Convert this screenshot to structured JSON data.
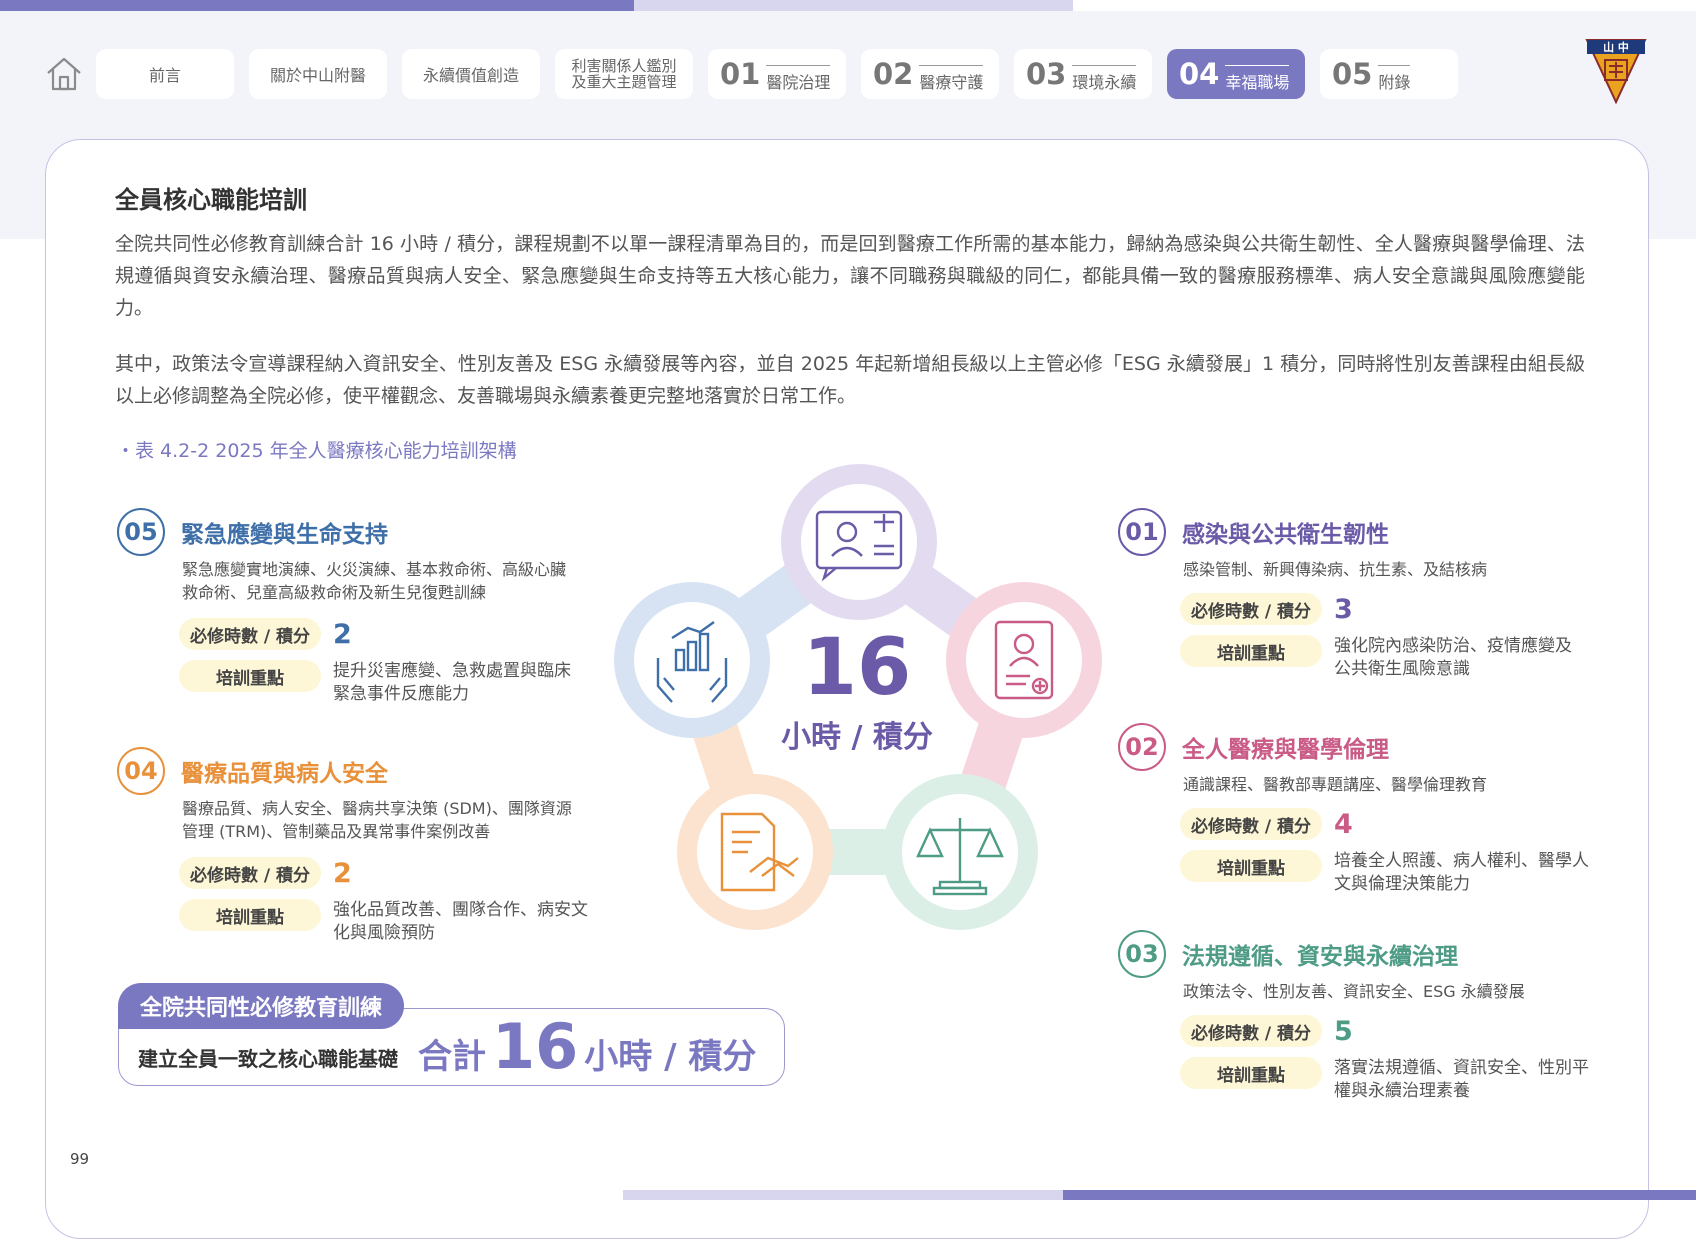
{
  "nav": {
    "tabs": [
      {
        "label": "前言"
      },
      {
        "label": "關於中山附醫"
      },
      {
        "label": "永續價值創造"
      },
      {
        "label_line1": "利害關係人鑑別",
        "label_line2": "及重大主題管理"
      },
      {
        "num": "01",
        "label": "醫院治理"
      },
      {
        "num": "02",
        "label": "醫療守護"
      },
      {
        "num": "03",
        "label": "環境永續"
      },
      {
        "num": "04",
        "label": "幸福職場"
      },
      {
        "num": "05",
        "label": "附錄"
      }
    ],
    "logo_text_top": "山 中"
  },
  "page": {
    "title": "全員核心職能培訓",
    "para1": "全院共同性必修教育訓練合計 16 小時 / 積分，課程規劃不以單一課程清單為目的，而是回到醫療工作所需的基本能力，歸納為感染與公共衛生韌性、全人醫療與醫學倫理、法規遵循與資安永續治理、醫療品質與病人安全、緊急應變與生命支持等五大核心能力，讓不同職務與職級的同仁，都能具備一致的醫療服務標準、病人安全意識與風險應變能力。",
    "para2": "其中，政策法令宣導課程納入資訊安全、性別友善及 ESG 永續發展等內容，並自 2025 年起新增組長級以上主管必修「ESG 永續發展」1 積分，同時將性別友善課程由組長級以上必修調整為全院必修，使平權觀念、友善職場與永續素養更完整地落實於日常工作。",
    "caption": "・表 4.2-2 2025 年全人醫療核心能力培訓架構",
    "page_number": "99"
  },
  "labels": {
    "hours": "必修時數 / 積分",
    "focus": "培訓重點"
  },
  "categories": {
    "c05": {
      "num": "05",
      "name": "緊急應變與生命支持",
      "desc1": "緊急應變實地演練、火災演練、基本救命術、高級心臟",
      "desc2": "救命術、兒童高級救命術及新生兒復甦訓練",
      "hours": "2",
      "focus1": "提升災害應變、急救處置與臨床",
      "focus2": "緊急事件反應能力",
      "color": "#3f6fa8"
    },
    "c04": {
      "num": "04",
      "name": "醫療品質與病人安全",
      "desc1": "醫療品質、病人安全、醫病共享決策 (SDM)、團隊資源",
      "desc2": "管理 (TRM)、管制藥品及異常事件案例改善",
      "hours": "2",
      "focus1": "強化品質改善、團隊合作、病安文",
      "focus2": "化與風險預防",
      "color": "#e8913a"
    },
    "c01": {
      "num": "01",
      "name": "感染與公共衛生韌性",
      "desc1": "感染管制、新興傳染病、抗生素、及結核病",
      "hours": "3",
      "focus1": "強化院內感染防治、疫情應變及",
      "focus2": "公共衛生風險意識",
      "color": "#6b5aa8"
    },
    "c02": {
      "num": "02",
      "name": "全人醫療與醫學倫理",
      "desc1": "通識課程、醫教部專題講座、醫學倫理教育",
      "hours": "4",
      "focus1": "培養全人照護、病人權利、醫學人",
      "focus2": "文與倫理決策能力",
      "color": "#c95b86"
    },
    "c03": {
      "num": "03",
      "name": "法規遵循、資安與永續治理",
      "desc1": "政策法令、性別友善、資訊安全、ESG 永續發展",
      "hours": "5",
      "focus1": "落實法規遵循、資訊安全、性別平",
      "focus2": "權與永續治理素養",
      "color": "#4e9b86"
    }
  },
  "center": {
    "number": "16",
    "unit": "小時 / 積分"
  },
  "summary": {
    "tag": "全院共同性必修教育訓練",
    "label": "建立全員一致之核心職能基礎",
    "prefix": "合計",
    "number": "16",
    "unit": "小時 / 積分"
  },
  "colors": {
    "accent": "#7b78c2",
    "pill": "#fdf7d7"
  }
}
